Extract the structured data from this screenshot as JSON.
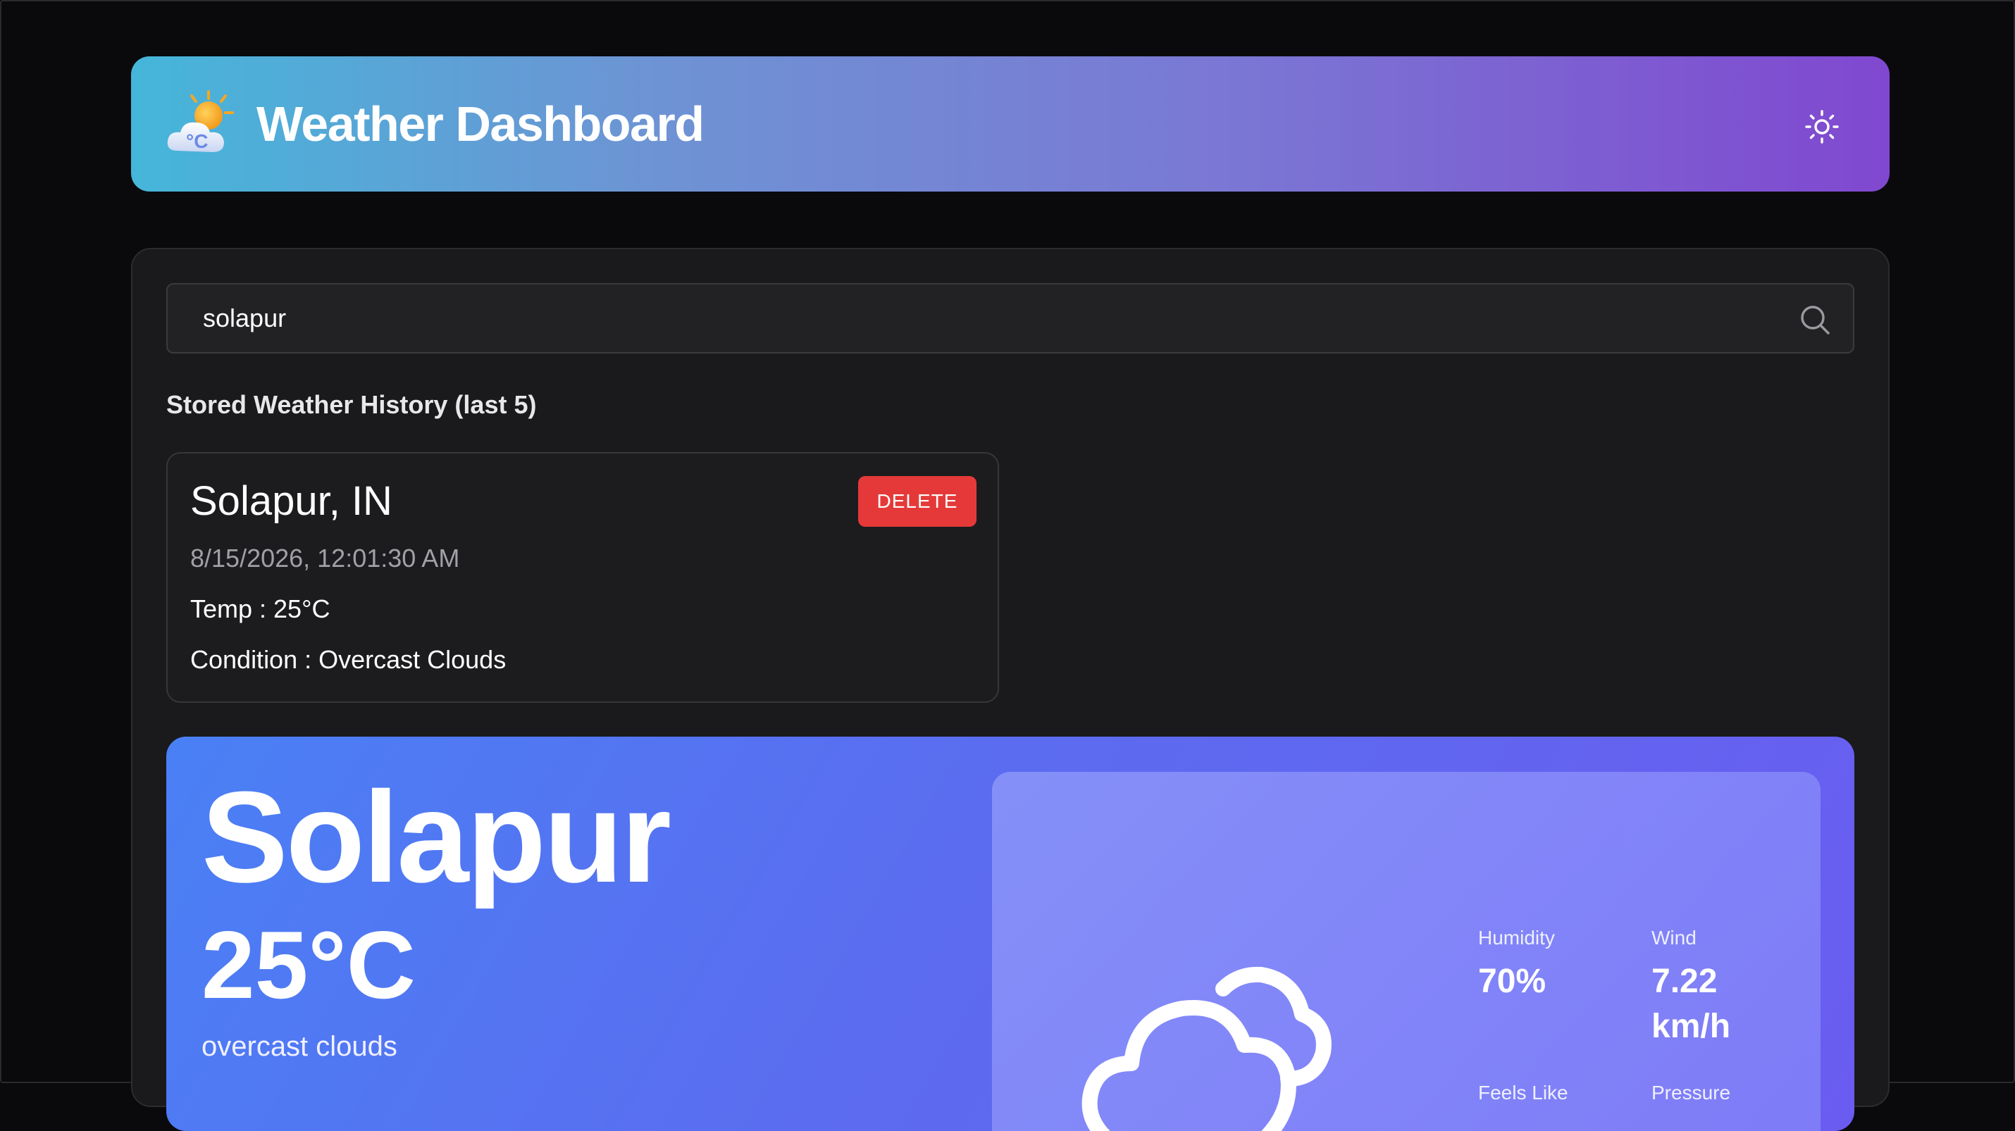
{
  "header": {
    "title": "Weather Dashboard",
    "logo_icon": "sun-behind-cloud-icon",
    "theme_toggle_icon": "sun-icon"
  },
  "search": {
    "value": "solapur",
    "placeholder": "",
    "icon": "search-icon"
  },
  "history": {
    "heading": "Stored Weather History (last 5)",
    "items": [
      {
        "city": "Solapur, IN",
        "timestamp": "8/15/2026, 12:01:30 AM",
        "temp_text": "Temp : 25°C",
        "condition_text": "Condition : Overcast Clouds",
        "delete_label": "DELETE"
      }
    ]
  },
  "current": {
    "city": "Solapur",
    "temperature": "25°C",
    "description": "overcast clouds",
    "icon": "cloud-icon",
    "stats": {
      "humidity_label": "Humidity",
      "humidity_value": "70%",
      "wind_label": "Wind",
      "wind_value": "7.22 km/h",
      "feels_like_label": "Feels Like",
      "pressure_label": "Pressure"
    }
  },
  "colors": {
    "header_gradient_start": "#45b6d9",
    "header_gradient_end": "#8048d0",
    "delete_button": "#e53939",
    "card_gradient_start": "#4a80f5",
    "card_gradient_end": "#6a5cf0",
    "background": "#0a0a0c"
  }
}
